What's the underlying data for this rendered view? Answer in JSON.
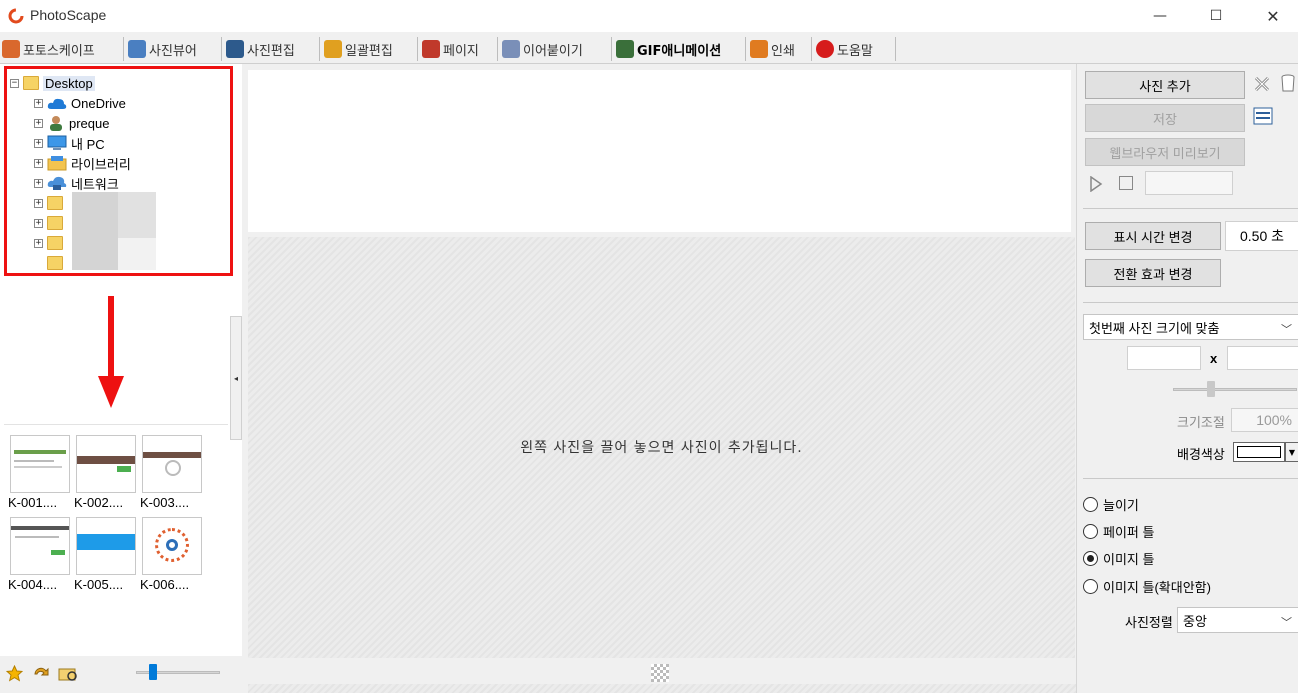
{
  "window": {
    "title": "PhotoScape"
  },
  "tabs": [
    {
      "label": "포토스케이프",
      "icon": "photoscape-icon",
      "color": "#d9682d"
    },
    {
      "label": "사진뷰어",
      "icon": "viewer-icon",
      "color": "#4a7fc1"
    },
    {
      "label": "사진편집",
      "icon": "editor-icon",
      "color": "#2d5a8c"
    },
    {
      "label": "일괄편집",
      "icon": "batch-icon",
      "color": "#e0a020"
    },
    {
      "label": "페이지",
      "icon": "page-icon",
      "color": "#c0392b"
    },
    {
      "label": "이어붙이기",
      "icon": "combine-icon",
      "color": "#7a8fb8"
    },
    {
      "label": "GIF애니메이션",
      "icon": "gif-icon",
      "color": "#3a6f3a"
    },
    {
      "label": "인쇄",
      "icon": "print-icon",
      "color": "#e07b20"
    },
    {
      "label": "도움말",
      "icon": "help-icon",
      "color": "#d61c1c"
    }
  ],
  "tree": {
    "root": "Desktop",
    "items": [
      {
        "label": "OneDrive",
        "icon": "cloud-icon"
      },
      {
        "label": "preque",
        "icon": "user-icon"
      },
      {
        "label": "내 PC",
        "icon": "computer-icon"
      },
      {
        "label": "라이브러리",
        "icon": "library-icon"
      },
      {
        "label": "네트워크",
        "icon": "network-icon"
      }
    ]
  },
  "thumbnails": [
    "K-001....",
    "K-002....",
    "K-003....",
    "K-004....",
    "K-005....",
    "K-006...."
  ],
  "drop_hint": "왼쪽 사진을 끌어 놓으면 사진이 추가됩니다.",
  "right_panel": {
    "add_photo": "사진 추가",
    "save": "저장",
    "browser_preview": "웹브라우저 미리보기",
    "display_time_btn": "표시 시간 변경",
    "display_time_value": "0.50 초",
    "transition_btn": "전환 효과 변경",
    "size_mode": "첫번째 사진 크기에 맞춤",
    "x_sep": "x",
    "resize_label": "크기조절",
    "resize_value": "100%",
    "bg_color_label": "배경색상",
    "bg_color": "#ffffff",
    "radios": [
      {
        "label": "늘이기",
        "checked": false
      },
      {
        "label": "페이퍼 틀",
        "checked": false
      },
      {
        "label": "이미지 틀",
        "checked": true
      },
      {
        "label": "이미지 틀(확대안함)",
        "checked": false
      }
    ],
    "align_label": "사진정렬",
    "align_value": "중앙"
  }
}
